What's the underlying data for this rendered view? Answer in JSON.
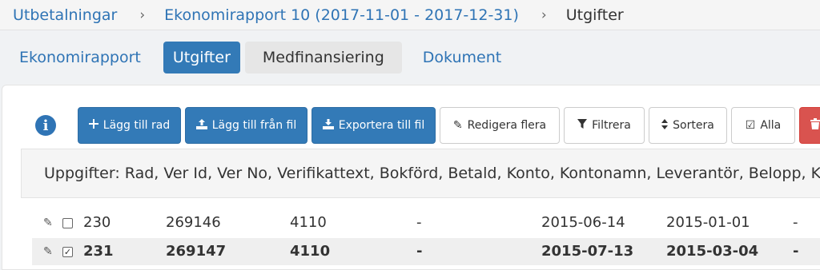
{
  "breadcrumb": {
    "item1": "Utbetalningar",
    "separator": "›",
    "item2": "Ekonomirapport 10 (2017-11-01 - 2017-12-31)",
    "current": "Utgifter"
  },
  "tabs": {
    "economy_report": "Ekonomirapport",
    "expenses": "Utgifter",
    "co_financing": "Medfinansiering",
    "documents": "Dokument"
  },
  "toolbar": {
    "info_icon": "i",
    "add_row": "Lägg till rad",
    "add_from_file": "Lägg till från fil",
    "export_to_file": "Exportera till fil",
    "edit_multiple": "Redigera flera",
    "filter": "Filtrera",
    "sort": "Sortera",
    "all": "Alla"
  },
  "description": "Uppgifter: Rad, Ver Id, Ver No, Verifikattext, Bokförd, Betald, Konto, Kontonamn, Leverantör, Belopp, K",
  "rows": [
    {
      "rad": "230",
      "ver_id": "269146",
      "ver_no": "4110",
      "text": "-",
      "bokford": "2015-06-14",
      "betald": "2015-01-01",
      "konto": "-",
      "checked": false
    },
    {
      "rad": "231",
      "ver_id": "269147",
      "ver_no": "4110",
      "text": "-",
      "bokford": "2015-07-13",
      "betald": "2015-03-04",
      "konto": "-",
      "checked": true
    }
  ],
  "colors": {
    "primary": "#337ab7",
    "link": "#2f74b5",
    "danger": "#d9534f"
  }
}
